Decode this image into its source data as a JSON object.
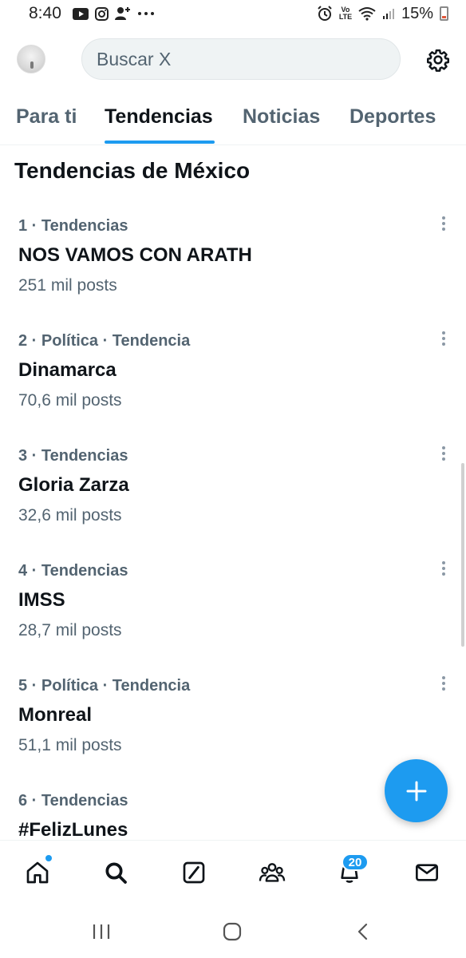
{
  "status_bar": {
    "time": "8:40",
    "battery": "15%",
    "volte_label": "Vo LTE"
  },
  "header": {
    "search_placeholder": "Buscar X"
  },
  "tabs": [
    {
      "label": "Para ti"
    },
    {
      "label": "Tendencias"
    },
    {
      "label": "Noticias"
    },
    {
      "label": "Deportes"
    }
  ],
  "section": {
    "title": "Tendencias de México"
  },
  "trends": [
    {
      "meta": "1 · Tendencias",
      "title": "NOS VAMOS CON ARATH",
      "count": "251 mil posts"
    },
    {
      "meta": "2 · Política · Tendencia",
      "title": "Dinamarca",
      "count": "70,6 mil posts"
    },
    {
      "meta": "3 · Tendencias",
      "title": "Gloria Zarza",
      "count": "32,6 mil posts"
    },
    {
      "meta": "4 · Tendencias",
      "title": "IMSS",
      "count": "28,7 mil posts"
    },
    {
      "meta": "5 · Política · Tendencia",
      "title": "Monreal",
      "count": "51,1 mil posts"
    },
    {
      "meta": "6 · Tendencias",
      "title": "#FelizLunes",
      "count": ""
    }
  ],
  "bottom_nav": {
    "notifications_badge": "20",
    "icons": [
      "home-icon",
      "search-icon",
      "grok-icon",
      "communities-icon",
      "notifications-icon",
      "messages-icon"
    ]
  },
  "colors": {
    "accent": "#1d9bf0",
    "text_primary": "#0f1419",
    "text_secondary": "#536471"
  }
}
